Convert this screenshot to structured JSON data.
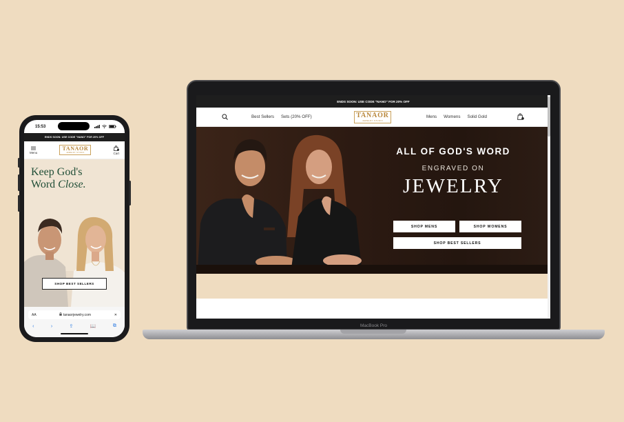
{
  "phone": {
    "status_time": "15:53",
    "promo_banner": "ENDS SOON: USE CODE \"NANO\" FOR 20% OFF",
    "menu_label": "Menu",
    "cart_label": "Cart",
    "logo_text": "TANAOR",
    "logo_tagline": "JEWELRY STUDIO",
    "headline_line1": "Keep God's",
    "headline_line2_a": "Word ",
    "headline_line2_b": "Close.",
    "shop_button": "SHOP BEST SELLERS",
    "url_aa": "AA",
    "url_text": "tanaorjewelry.com",
    "url_close": "✕",
    "toolbar": [
      "‹",
      "›",
      "⇪",
      "📖",
      "⧉"
    ]
  },
  "laptop": {
    "device_label": "MacBook Pro",
    "promo_banner": "ENDS SOON: USE CODE \"NANO\" FOR 20% OFF",
    "nav_left": [
      "Best Sellers",
      "Sets (20% OFF)"
    ],
    "nav_right": [
      "Mens",
      "Womens",
      "Solid Gold"
    ],
    "logo_text": "TANAOR",
    "logo_tagline": "JEWELRY STUDIO",
    "hero_line1": "ALL OF GOD'S WORD",
    "hero_line2": "ENGRAVED ON",
    "hero_line3": "JEWELRY",
    "btn_mens": "SHOP MENS",
    "btn_womens": "SHOP WOMENS",
    "btn_best": "SHOP BEST SELLERS"
  },
  "colors": {
    "background": "#efdcc0",
    "headline_green": "#1f4d36",
    "logo_gold": "#b8863a",
    "hero_brown": "#2c1a12"
  }
}
